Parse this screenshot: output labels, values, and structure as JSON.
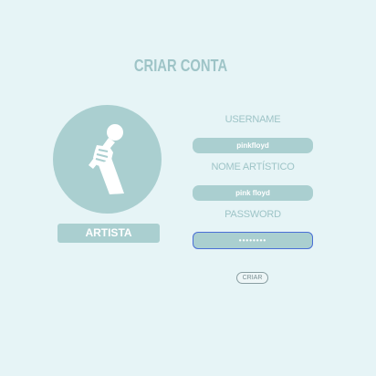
{
  "page": {
    "title": "CRIAR CONTA"
  },
  "avatar": {
    "icon": "microphone-hand-icon",
    "role_label": "ARTISTA"
  },
  "form": {
    "username_label": "USERNAME",
    "username_value": "pinkfloyd",
    "artist_name_label": "NOME ARTÍSTICO",
    "artist_name_value": "pink floyd",
    "password_label": "PASSWORD",
    "password_value": "••••••••",
    "submit_label": "CRIAR"
  },
  "colors": {
    "background": "#e6f4f6",
    "accent": "#aacfd0",
    "text_accent": "#9ec4c7",
    "focus_border": "#4a6fd6"
  }
}
